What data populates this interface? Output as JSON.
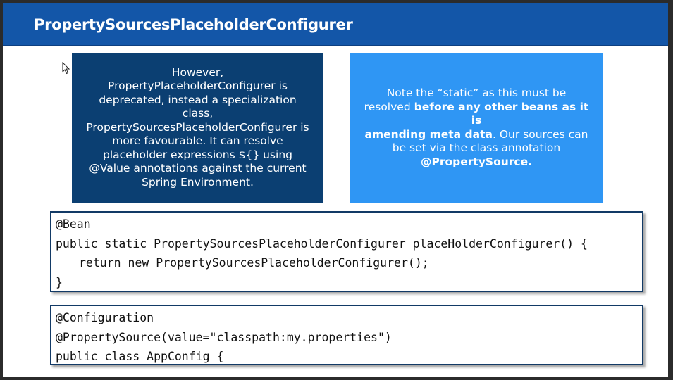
{
  "slide": {
    "title": "PropertySourcesPlaceholderConfigurer"
  },
  "left_box": {
    "lines": [
      "However,",
      "PropertyPlaceholderConfigurer is",
      "deprecated, instead a specialization",
      "class,",
      "PropertySourcesPlaceholderConfigurer is",
      "more favourable. It can resolve",
      "placeholder expressions ${} using",
      "@Value annotations against the current",
      "Spring Environment."
    ]
  },
  "right_box": {
    "line1": "Note the “static” as this must be",
    "line2_normal": "resolved ",
    "line2_bold": "before any other beans as it is",
    "line3_bold": "amending meta data",
    "line3_normal": ". Our sources can",
    "line4": "be set via the class annotation",
    "line5_bold": "@PropertySource."
  },
  "code_block_1": {
    "lines": [
      "@Bean",
      "public static PropertySourcesPlaceholderConfigurer placeHolderConfigurer() {",
      "return new PropertySourcesPlaceholderConfigurer();",
      "}"
    ]
  },
  "code_block_2": {
    "lines": [
      "@Configuration",
      "@PropertySource(value=\"classpath:my.properties\")",
      "public class AppConfig {"
    ]
  },
  "colors": {
    "title_bar": "#1356a8",
    "dark_box": "#0b3f72",
    "light_box": "#2f96f4",
    "code_border": "#123a66"
  },
  "icons": {
    "cursor": "mouse-pointer-icon"
  }
}
